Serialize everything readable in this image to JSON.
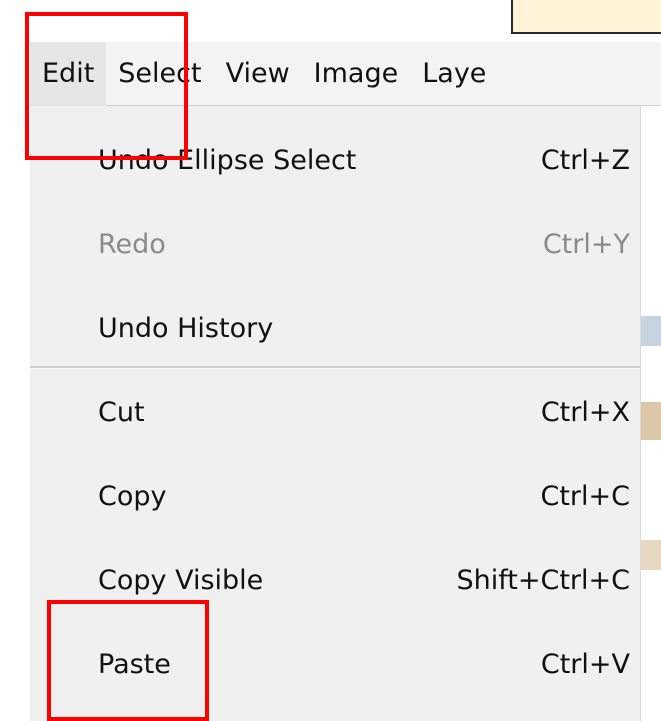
{
  "menubar": {
    "items": [
      {
        "label": "Edit"
      },
      {
        "label": "Select"
      },
      {
        "label": "View"
      },
      {
        "label": "Image"
      },
      {
        "label": "Laye"
      }
    ]
  },
  "edit_menu": {
    "items": [
      {
        "label": "Undo Ellipse Select",
        "shortcut": "Ctrl+Z",
        "enabled": true
      },
      {
        "label": "Redo",
        "shortcut": "Ctrl+Y",
        "enabled": false
      },
      {
        "label": "Undo History",
        "shortcut": "",
        "enabled": true
      },
      {
        "label": "Cut",
        "shortcut": "Ctrl+X",
        "enabled": true
      },
      {
        "label": "Copy",
        "shortcut": "Ctrl+C",
        "enabled": true
      },
      {
        "label": "Copy Visible",
        "shortcut": "Shift+Ctrl+C",
        "enabled": true
      },
      {
        "label": "Paste",
        "shortcut": "Ctrl+V",
        "enabled": true
      }
    ]
  },
  "colors": {
    "highlight": "#ff0000",
    "menu_background": "#f0f0f0",
    "disabled_text": "#8a8a8a",
    "note_background": "#fff5d6"
  }
}
